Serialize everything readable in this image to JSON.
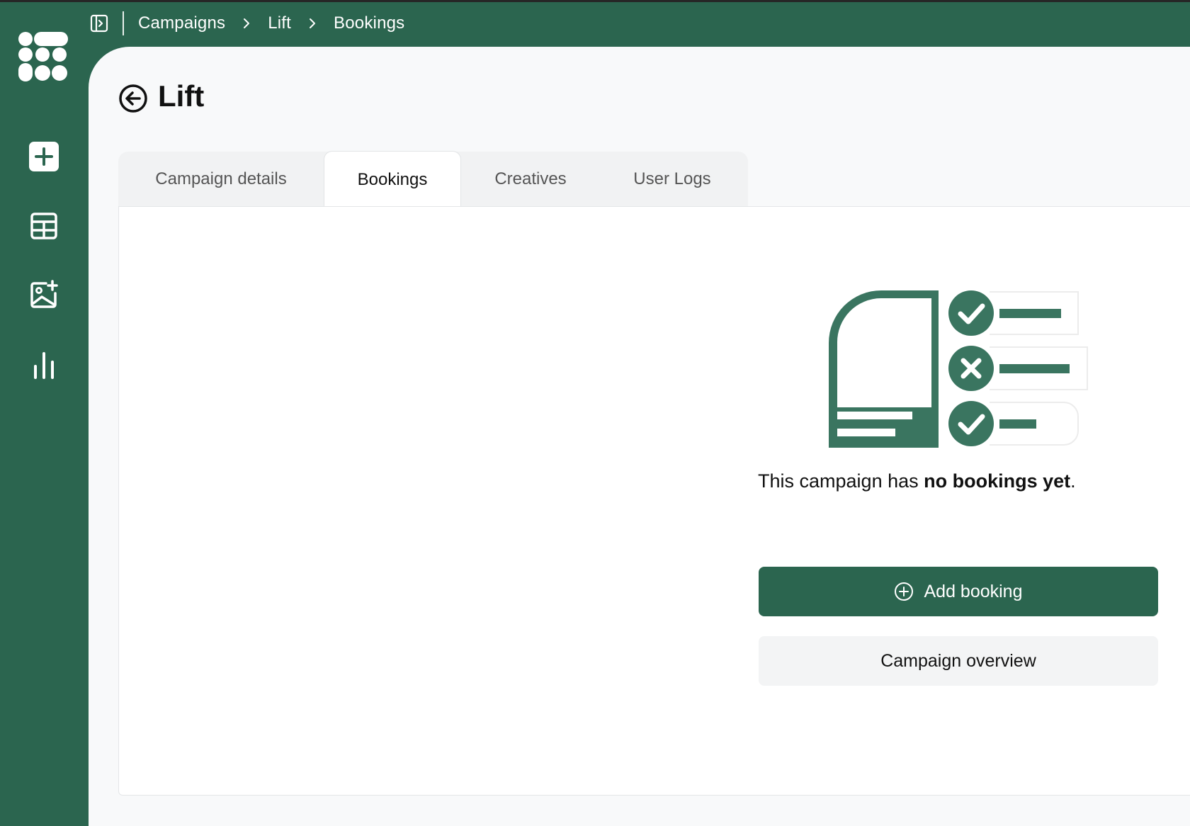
{
  "breadcrumb": [
    "Campaigns",
    "Lift",
    "Bookings"
  ],
  "page": {
    "title": "Lift"
  },
  "tabs": [
    {
      "label": "Campaign details",
      "active": false
    },
    {
      "label": "Bookings",
      "active": true
    },
    {
      "label": "Creatives",
      "active": false
    },
    {
      "label": "User Logs",
      "active": false
    }
  ],
  "sidebar": {
    "items": [
      {
        "icon": "plus-square-icon"
      },
      {
        "icon": "table-icon"
      },
      {
        "icon": "image-add-icon"
      },
      {
        "icon": "bar-chart-icon"
      }
    ]
  },
  "empty_state": {
    "prefix": "This campaign has ",
    "emphasis": "no bookings yet",
    "suffix": "."
  },
  "actions": {
    "add_booking": "Add booking",
    "campaign_overview": "Campaign overview"
  },
  "colors": {
    "brand": "#2b654f",
    "illustration": "#3a7560"
  }
}
